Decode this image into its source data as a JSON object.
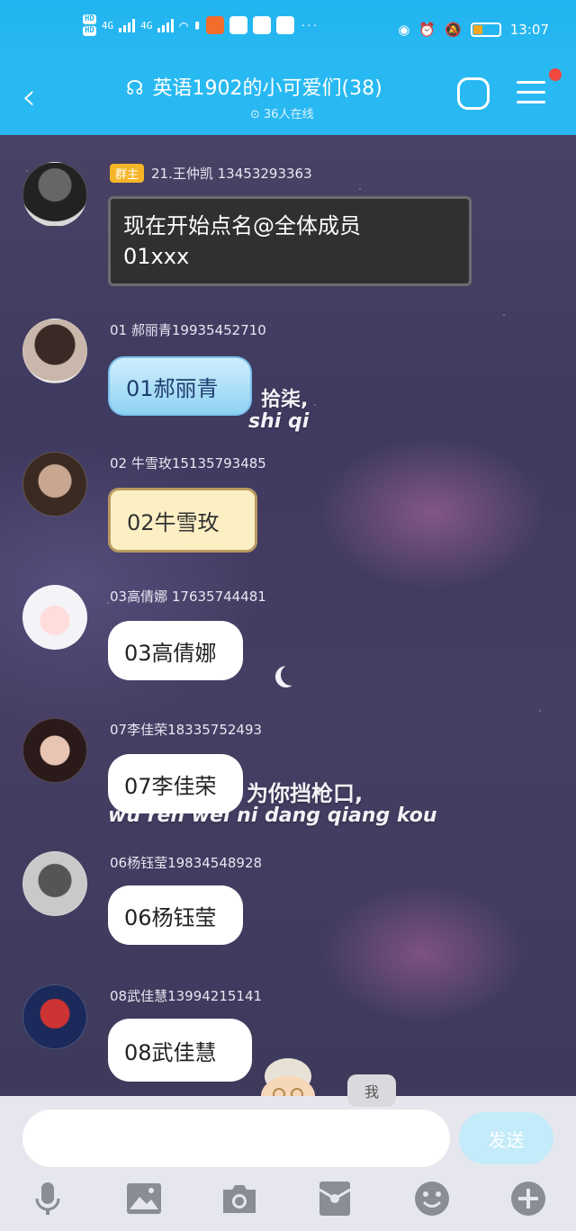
{
  "status_bar": {
    "hd1": "HD",
    "hd2": "HD",
    "net1": "4G",
    "net2": "4G",
    "more": "···",
    "time": "13:07"
  },
  "header": {
    "back_icon": "chevron-left-icon",
    "title": "英语1902的小可爱们(38)",
    "online": "36人在线",
    "colors": {
      "bg": "#29b9f2"
    }
  },
  "messages": [
    {
      "badge": "群主",
      "sender": "21.王仲凯 13453293363",
      "lines": [
        "现在开始点名@全体成员",
        "01xxx"
      ],
      "style": "dark"
    },
    {
      "sender": "01 郝丽青19935452710",
      "text": "01郝丽青",
      "style": "blue"
    },
    {
      "sender": "02 牛雪玫15135793485",
      "text": "02牛雪玫",
      "style": "yellow"
    },
    {
      "sender": "03高倩娜 17635744481",
      "text": "03高倩娜",
      "style": "white"
    },
    {
      "sender": "07李佳荣18335752493",
      "text": "07李佳荣",
      "style": "white"
    },
    {
      "sender": "06杨钰莹19834548928",
      "text": "06杨钰莹",
      "style": "white"
    },
    {
      "sender": "08武佳慧13994215141",
      "text": "08武佳慧",
      "style": "white"
    }
  ],
  "background_lyrics": {
    "line1_cn": "拾柒,",
    "line1_py": "shi qi",
    "line2_cn": "为你挡枪口,",
    "line2_py": "wu ren wei ni dang qiang kou"
  },
  "input": {
    "me_label": "我",
    "send_label": "发送",
    "placeholder": ""
  },
  "toolbar": [
    "microphone-icon",
    "image-icon",
    "camera-icon",
    "red-packet-icon",
    "emoji-icon",
    "plus-icon"
  ]
}
